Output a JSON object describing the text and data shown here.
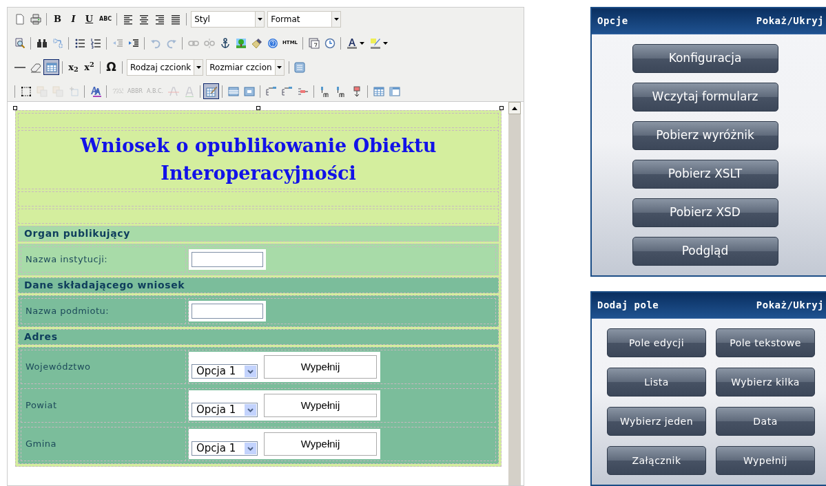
{
  "toolbar": {
    "rows": [
      {
        "items": [
          {
            "kind": "icon",
            "disabled": false,
            "selected": false
          },
          {
            "kind": "icon",
            "disabled": false,
            "selected": false
          },
          {
            "kind": "separator"
          },
          {
            "kind": "text",
            "label": "B",
            "disabled": false,
            "selected": false
          },
          {
            "kind": "text",
            "label": "I",
            "disabled": false,
            "selected": false
          },
          {
            "kind": "text",
            "label": "U",
            "disabled": false,
            "selected": false
          },
          {
            "kind": "text",
            "label": "ABC",
            "disabled": false,
            "selected": false
          },
          {
            "kind": "separator"
          },
          {
            "kind": "icon",
            "disabled": false,
            "selected": false
          },
          {
            "kind": "icon",
            "disabled": false,
            "selected": false
          },
          {
            "kind": "icon",
            "disabled": false,
            "selected": false
          },
          {
            "kind": "icon",
            "disabled": false,
            "selected": false
          },
          {
            "kind": "separator"
          },
          {
            "kind": "select",
            "value": "Styl"
          },
          {
            "kind": "select",
            "value": "Format"
          }
        ]
      },
      {
        "items": [
          {
            "kind": "icon",
            "disabled": false,
            "selected": false
          },
          {
            "kind": "separator"
          },
          {
            "kind": "icon",
            "disabled": false,
            "selected": false
          },
          {
            "kind": "icon",
            "disabled": false,
            "selected": false
          },
          {
            "kind": "separator"
          },
          {
            "kind": "icon",
            "disabled": false,
            "selected": false
          },
          {
            "kind": "icon",
            "disabled": false,
            "selected": false
          },
          {
            "kind": "separator"
          },
          {
            "kind": "icon",
            "disabled": true,
            "selected": false
          },
          {
            "kind": "icon",
            "disabled": false,
            "selected": false
          },
          {
            "kind": "separator"
          },
          {
            "kind": "icon",
            "disabled": true,
            "selected": false
          },
          {
            "kind": "icon",
            "disabled": true,
            "selected": false
          },
          {
            "kind": "separator"
          },
          {
            "kind": "icon",
            "disabled": true,
            "selected": false
          },
          {
            "kind": "icon",
            "disabled": true,
            "selected": false
          },
          {
            "kind": "icon",
            "disabled": false,
            "selected": false
          },
          {
            "kind": "icon",
            "disabled": false,
            "selected": false
          },
          {
            "kind": "icon",
            "disabled": false,
            "selected": false
          },
          {
            "kind": "icon",
            "disabled": false,
            "selected": false
          },
          {
            "kind": "text",
            "label": "HTML",
            "disabled": false,
            "selected": false
          },
          {
            "kind": "separator"
          },
          {
            "kind": "icon",
            "disabled": false,
            "selected": false
          },
          {
            "kind": "icon",
            "disabled": false,
            "selected": false
          },
          {
            "kind": "separator"
          },
          {
            "kind": "dropdown",
            "disabled": false,
            "selected": false
          },
          {
            "kind": "dropdown",
            "disabled": false,
            "selected": false
          }
        ]
      },
      {
        "items": [
          {
            "kind": "icon",
            "disabled": false,
            "selected": false
          },
          {
            "kind": "icon",
            "disabled": false,
            "selected": false
          },
          {
            "kind": "icon",
            "disabled": false,
            "selected": true
          },
          {
            "kind": "separator"
          },
          {
            "kind": "text",
            "label": "x$_{2}$",
            "disabled": false,
            "selected": false
          },
          {
            "kind": "text",
            "label": "x$^{2}$",
            "disabled": false,
            "selected": false
          },
          {
            "kind": "separator"
          },
          {
            "kind": "text",
            "label": "Ω",
            "disabled": false,
            "selected": false
          },
          {
            "kind": "separator"
          },
          {
            "kind": "select",
            "value": "Rodzaj czcionk"
          },
          {
            "kind": "select",
            "value": "Rozmiar czcion"
          },
          {
            "kind": "separator"
          },
          {
            "kind": "icon",
            "disabled": false,
            "selected": false
          }
        ]
      },
      {
        "items": [
          {
            "kind": "separator"
          },
          {
            "kind": "icon",
            "disabled": false,
            "selected": false
          },
          {
            "kind": "icon",
            "disabled": true,
            "selected": false
          },
          {
            "kind": "icon",
            "disabled": true,
            "selected": false
          },
          {
            "kind": "icon",
            "disabled": true,
            "selected": false
          },
          {
            "kind": "separator"
          },
          {
            "kind": "icon",
            "disabled": false,
            "selected": false
          },
          {
            "kind": "separator"
          },
          {
            "kind": "icon",
            "disabled": true,
            "selected": false
          },
          {
            "kind": "text",
            "label": "ABBR",
            "disabled": true,
            "selected": false
          },
          {
            "kind": "text",
            "label": "A.B.C.",
            "disabled": true,
            "selected": false
          },
          {
            "kind": "icon",
            "disabled": true,
            "selected": false
          },
          {
            "kind": "icon",
            "disabled": true,
            "selected": false
          },
          {
            "kind": "separator"
          },
          {
            "kind": "icon",
            "disabled": false,
            "selected": true
          },
          {
            "kind": "separator"
          },
          {
            "kind": "icon",
            "disabled": false,
            "selected": false
          },
          {
            "kind": "icon",
            "disabled": false,
            "selected": false
          },
          {
            "kind": "separator"
          },
          {
            "kind": "icon",
            "disabled": false,
            "selected": false
          },
          {
            "kind": "icon",
            "disabled": false,
            "selected": false
          },
          {
            "kind": "icon",
            "disabled": false,
            "selected": false
          },
          {
            "kind": "separator"
          },
          {
            "kind": "icon",
            "disabled": false,
            "selected": false
          },
          {
            "kind": "icon",
            "disabled": false,
            "selected": false
          },
          {
            "kind": "icon",
            "disabled": false,
            "selected": false
          },
          {
            "kind": "separator"
          },
          {
            "kind": "icon",
            "disabled": false,
            "selected": false
          },
          {
            "kind": "icon",
            "disabled": false,
            "selected": false
          }
        ]
      }
    ]
  },
  "document": {
    "title": "Wniosek o opublikowanie Obiektu Interoperacyjności",
    "sections": [
      {
        "heading": "Organ publikujący",
        "color": "#a8dba8",
        "fields": [
          {
            "label": "Nazwa instytucji:",
            "kind": "text-input"
          }
        ]
      },
      {
        "heading": "Dane składającego wniosek",
        "color": "#7bbd9b",
        "fields": [
          {
            "label": "Nazwa podmiotu:",
            "kind": "text-input"
          }
        ]
      },
      {
        "heading": "Adres",
        "color": "#7bbd9b",
        "fields": [
          {
            "label": "Województwo",
            "kind": "select-fill",
            "value": "Opcja 1",
            "button": "Wypełnij"
          },
          {
            "label": "Powiat",
            "kind": "select-fill",
            "value": "Opcja 1",
            "button": "Wypełnij"
          },
          {
            "label": "Gmina",
            "kind": "select-fill",
            "value": "Opcja 1",
            "button": "Wypełnij"
          }
        ]
      }
    ]
  },
  "panels": [
    {
      "title": "Opcje",
      "toggle": "Pokaż/Ukryj",
      "buttons": [
        "Konfiguracja",
        "Wczytaj formularz",
        "Pobierz wyróżnik",
        "Pobierz XSLT",
        "Pobierz XSD",
        "Podgląd"
      ]
    },
    {
      "title": "Dodaj pole",
      "toggle": "Pokaż/Ukryj",
      "buttons": [
        "Pole edycji",
        "Pole tekstowe",
        "Lista",
        "Wybierz kilka",
        "Wybierz jeden",
        "Data",
        "Załącznik",
        "Wypełnij"
      ]
    }
  ]
}
